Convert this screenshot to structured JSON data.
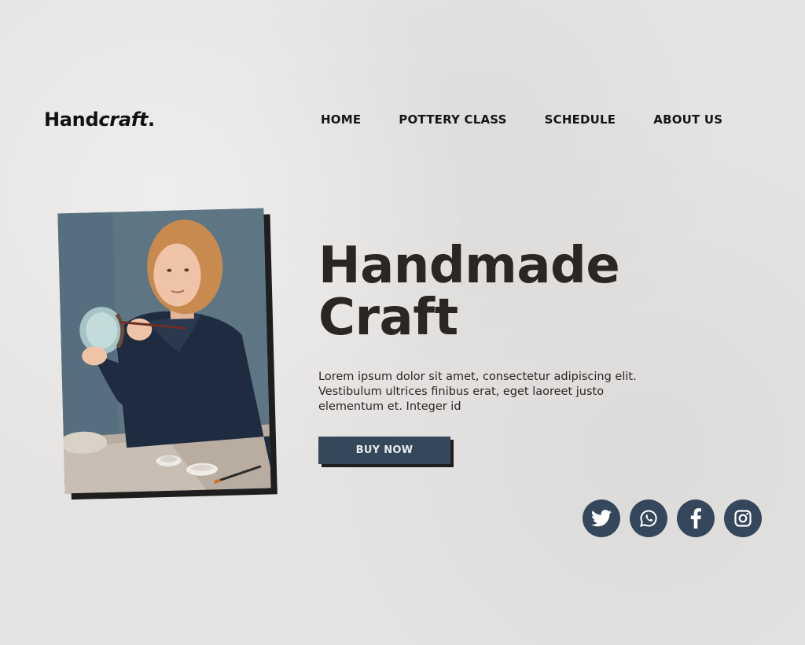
{
  "brand": {
    "logo_bold": "Hand",
    "logo_italic": "craft",
    "logo_dot": "."
  },
  "nav": {
    "items": [
      {
        "label": "HOME"
      },
      {
        "label": "POTTERY CLASS"
      },
      {
        "label": "SCHEDULE"
      },
      {
        "label": "ABOUT US"
      }
    ]
  },
  "hero": {
    "title_line1": "Handmade",
    "title_line2": "Craft",
    "description": "Lorem ipsum dolor sit amet, consectetur adipiscing elit. Vestibulum ultrices finibus erat, eget laoreet justo elementum et. Integer id",
    "button_label": "BUY NOW"
  },
  "social": [
    {
      "icon": "twitter-icon"
    },
    {
      "icon": "whatsapp-icon"
    },
    {
      "icon": "facebook-icon"
    },
    {
      "icon": "instagram-icon"
    }
  ],
  "colors": {
    "background": "#e6e4e2",
    "accent": "#35475a",
    "title_text": "#2b2624"
  }
}
